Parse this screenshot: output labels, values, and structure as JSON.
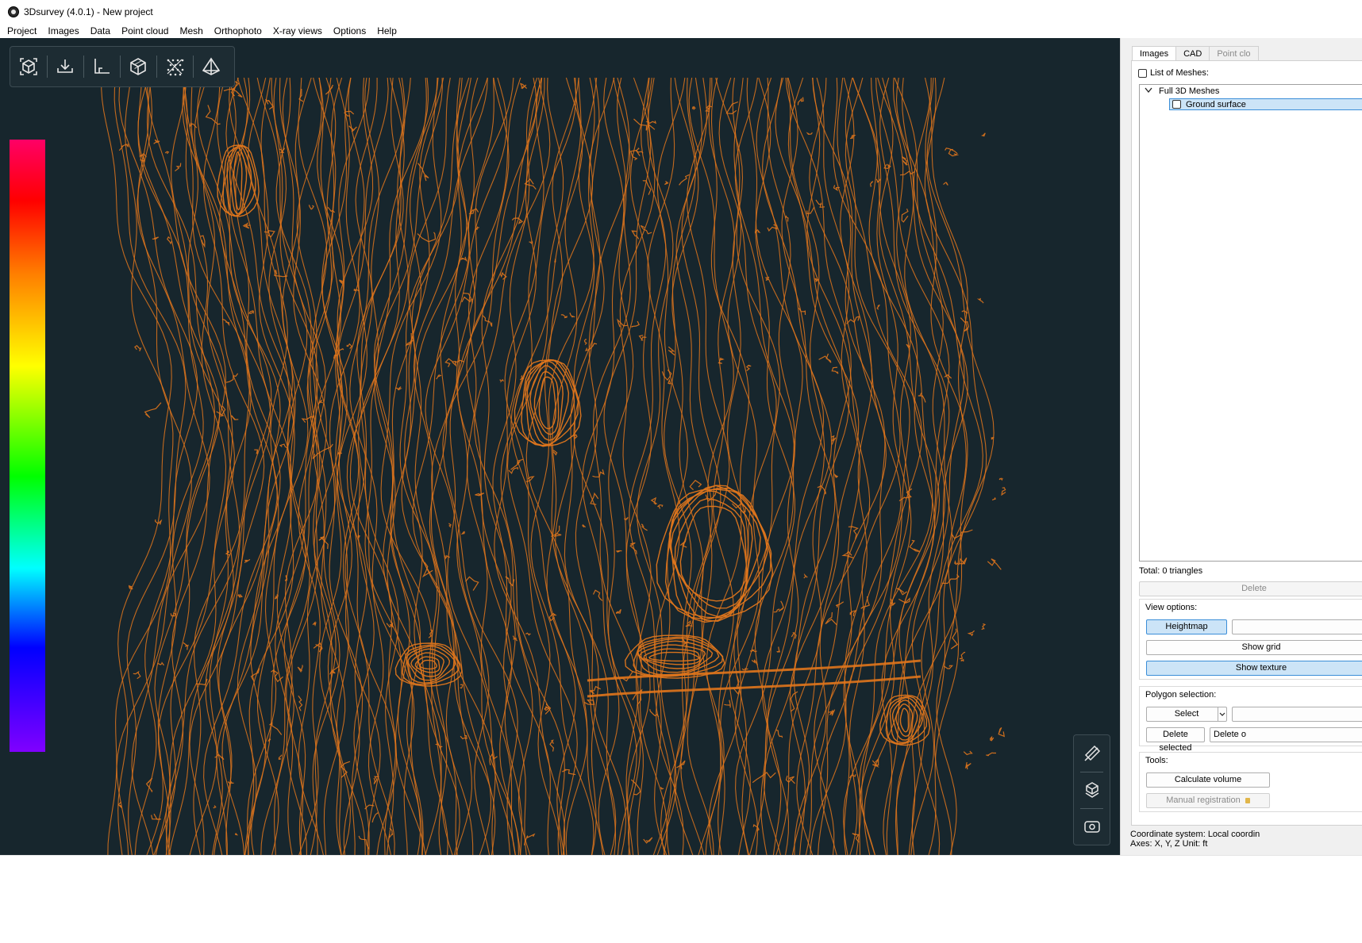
{
  "window": {
    "title": "3Dsurvey (4.0.1) - New project"
  },
  "menu": [
    "Project",
    "Images",
    "Data",
    "Point cloud",
    "Mesh",
    "Orthophoto",
    "X-ray views",
    "Options",
    "Help"
  ],
  "toolbar_icons": [
    "scene-view-icon",
    "import-icon",
    "axes-icon",
    "cube-icon",
    "point-cloud-icon",
    "pyramid-icon"
  ],
  "side_toolbar_icons": [
    "measure-icon",
    "layers-icon",
    "camera-icon"
  ],
  "colorbar": {
    "stops": [
      "#ff0066",
      "#ff0000",
      "#ff7f00",
      "#ffff00",
      "#00ff00",
      "#00ffff",
      "#0000ff",
      "#8000ff"
    ]
  },
  "contour_color": "#e0761c",
  "viewport_bg": "#17262d",
  "panel": {
    "tabs": [
      {
        "label": "Images",
        "active": true
      },
      {
        "label": "CAD",
        "active": false
      },
      {
        "label": "Point clo",
        "disabled": true
      }
    ],
    "list_of_meshes_label": "List of Meshes:",
    "tree": {
      "group": "Full 3D Meshes",
      "item": "Ground surface"
    },
    "total": "Total: 0 triangles",
    "delete_label": "Delete",
    "view_options": {
      "title": "View options:",
      "heightmap": "Heightmap",
      "show_grid": "Show grid",
      "show_texture": "Show texture"
    },
    "polygon_selection": {
      "title": "Polygon selection:",
      "select": "Select",
      "delete_selected": "Delete selected",
      "delete_other": "Delete o"
    },
    "tools": {
      "title": "Tools:",
      "calculate_volume": "Calculate volume",
      "manual_registration": "Manual registration"
    },
    "status_line1": "Coordinate system: Local coordin",
    "status_line2": "Axes: X, Y, Z Unit: ft"
  }
}
